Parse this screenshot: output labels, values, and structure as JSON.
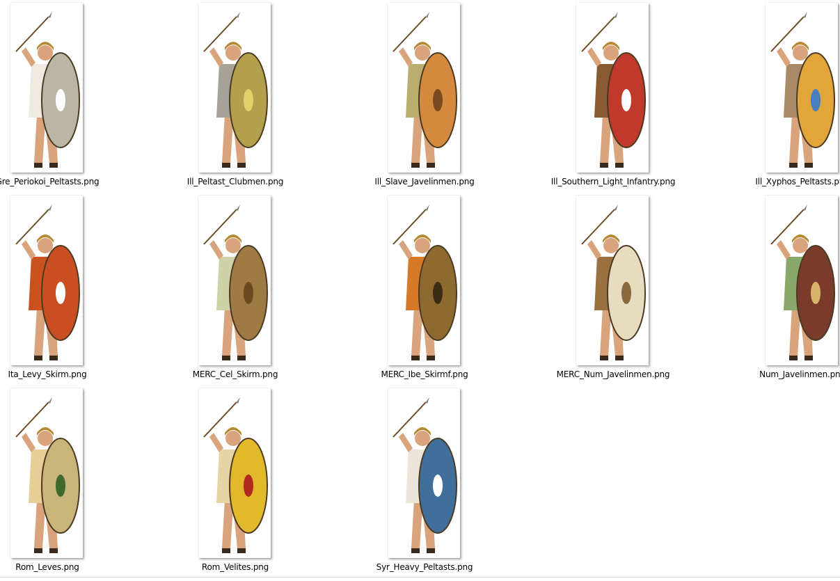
{
  "files": [
    {
      "name": "Gre_Periokoi_Peltasts.png",
      "icon": "spearman-thumbnail-icon",
      "tunic": "#eeeae2",
      "shield": "#b9b6a6",
      "shield_mark": "#ffffff"
    },
    {
      "name": "Ill_Peltast_Clubmen.png",
      "icon": "clubman-thumbnail-icon",
      "tunic": "#a6a298",
      "shield": "#b3a04c",
      "shield_mark": "#e2d26a"
    },
    {
      "name": "Ill_Slave_Javelinmen.png",
      "icon": "javelinman-thumbnail-icon",
      "tunic": "#b9ae6e",
      "shield": "#d38a3e",
      "shield_mark": "#7a4a20"
    },
    {
      "name": "Ill_Southern_Light_Infantry.png",
      "icon": "infantryman-thumbnail-icon",
      "tunic": "#8a5a30",
      "shield": "#c0392b",
      "shield_mark": "#ffffff"
    },
    {
      "name": "Ill_Xyphos_Peltasts.png",
      "icon": "peltast-thumbnail-icon",
      "tunic": "#a88a66",
      "shield": "#e2a53a",
      "shield_mark": "#4a7cc0"
    },
    {
      "name": "Ita_Levy_Skirm.png",
      "icon": "skirmisher-thumbnail-icon",
      "tunic": "#c9521f",
      "shield": "#c94f22",
      "shield_mark": "#ffffff"
    },
    {
      "name": "MERC_Cel_Skirm.png",
      "icon": "skirmisher-thumbnail-icon",
      "tunic": "#cfd2a8",
      "shield": "#a07a44",
      "shield_mark": "#6b4a22"
    },
    {
      "name": "MERC_Ibe_Skirmf.png",
      "icon": "skirmisher-thumbnail-icon",
      "tunic": "#d67a2a",
      "shield": "#8f6a30",
      "shield_mark": "#3c2c14"
    },
    {
      "name": "MERC_Num_Javelinmen.png",
      "icon": "javelinman-thumbnail-icon",
      "tunic": "#9a7040",
      "shield": "#e8dcc0",
      "shield_mark": "#8a6a40"
    },
    {
      "name": "Num_Javelinmen.png",
      "icon": "javelinman-thumbnail-icon",
      "tunic": "#8aa76a",
      "shield": "#7a3a2c",
      "shield_mark": "#d8b468"
    },
    {
      "name": "Rom_Leves.png",
      "icon": "skirmisher-thumbnail-icon",
      "tunic": "#e6cf96",
      "shield": "#c9b47a",
      "shield_mark": "#3e6a2c"
    },
    {
      "name": "Rom_Velites.png",
      "icon": "velite-thumbnail-icon",
      "tunic": "#e6d4a4",
      "shield": "#e3b92c",
      "shield_mark": "#b0281e"
    },
    {
      "name": "Syr_Heavy_Peltasts.png",
      "icon": "heavy-peltast-thumbnail-icon",
      "tunic": "#ece6d8",
      "shield": "#3f6f9a",
      "shield_mark": "#ffffff"
    }
  ]
}
